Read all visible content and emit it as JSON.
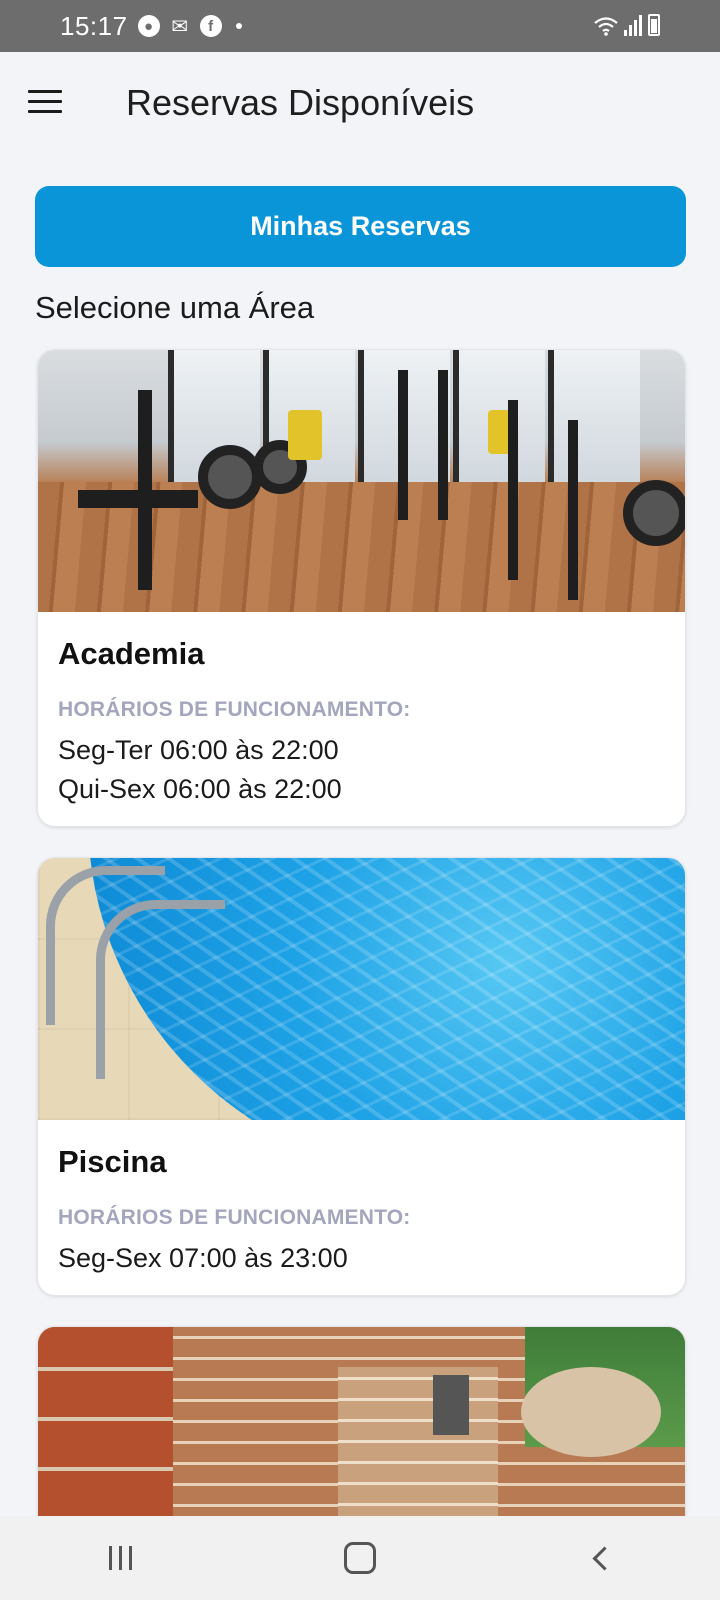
{
  "status_bar": {
    "time": "15:17",
    "icons": [
      "account-icon",
      "gmail-icon",
      "facebook-icon",
      "notification-dot",
      "wifi-icon",
      "signal-icon",
      "battery-icon"
    ]
  },
  "app_bar": {
    "title": "Reservas Disponíveis",
    "menu_icon": "menu-icon"
  },
  "primary_button": {
    "label": "Minhas Reservas",
    "color": "#0a95d9"
  },
  "section_label": "Selecione uma Área",
  "areas": [
    {
      "name": "Academia",
      "hours_label": "HORÁRIOS DE FUNCIONAMENTO:",
      "hours": [
        "Seg-Ter 06:00 às 22:00",
        "Qui-Sex 06:00 às 22:00"
      ]
    },
    {
      "name": "Piscina",
      "hours_label": "HORÁRIOS DE FUNCIONAMENTO:",
      "hours": [
        "Seg-Sex 07:00 às 23:00"
      ]
    },
    {
      "name": "",
      "hours_label": "",
      "hours": []
    }
  ],
  "nav_bar": {
    "buttons": [
      "recent-apps-icon",
      "home-icon",
      "back-icon"
    ]
  },
  "colors": {
    "background": "#f2f4f8",
    "hours_label": "#a3a6bd",
    "status_bar": "#6d6d6d"
  }
}
